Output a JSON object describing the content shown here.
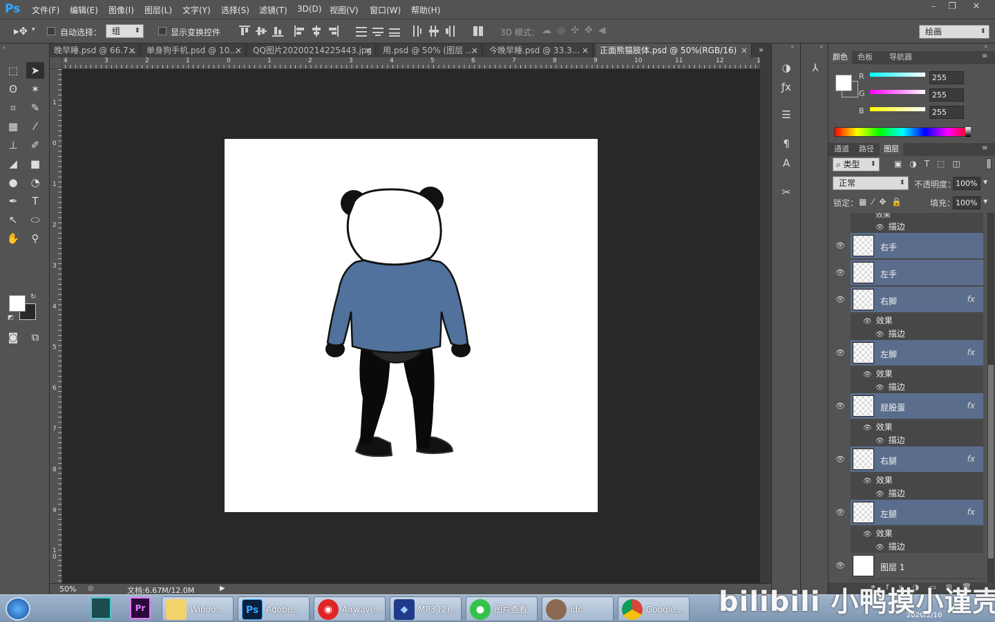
{
  "app": {
    "logo": "Ps"
  },
  "menu": [
    "文件(F)",
    "编辑(E)",
    "图像(I)",
    "图层(L)",
    "文字(Y)",
    "选择(S)",
    "滤镜(T)",
    "3D(D)",
    "视图(V)",
    "窗口(W)",
    "帮助(H)"
  ],
  "options": {
    "auto_select_label": "自动选择：",
    "auto_select_value": "组",
    "show_transform_label": "显示变换控件",
    "mode3d_label": "3D 模式：",
    "workspace": "绘画"
  },
  "tabs": [
    {
      "label": "晚早睡.psd @ 66.7...",
      "close": "×"
    },
    {
      "label": "单身狗手机.psd @ 10...",
      "close": "×"
    },
    {
      "label": "QQ图片20200214225443.jpg",
      "close": "×"
    },
    {
      "label": "用.psd @ 50% (图层 ...",
      "close": "×"
    },
    {
      "label": "今晚早睡.psd @ 33.3...",
      "close": "×"
    },
    {
      "label": "正面熊猫肢体.psd @ 50%(RGB/16)",
      "close": "×"
    }
  ],
  "ruler_top": [
    "4",
    "3",
    "2",
    "1",
    "0",
    "1",
    "2",
    "3",
    "4",
    "5",
    "6",
    "7",
    "8",
    "9",
    "10",
    "11",
    "12",
    "1"
  ],
  "ruler_left": [
    "1",
    "0",
    "1",
    "2",
    "3",
    "4",
    "5",
    "6",
    "7",
    "8",
    "9",
    "1 0"
  ],
  "status": {
    "zoom": "50%",
    "doc": "文档:6.67M/12.0M"
  },
  "color_panel": {
    "tabs": [
      "颜色",
      "色板",
      "导航器"
    ],
    "r_label": "R",
    "g_label": "G",
    "b_label": "B",
    "r": "255",
    "g": "255",
    "b": "255"
  },
  "layers_panel": {
    "tabs": [
      "通道",
      "路径",
      "图层"
    ],
    "filter": "类型",
    "blend_mode": "正常",
    "opacity_label": "不透明度：",
    "opacity": "100%",
    "lock_label": "锁定：",
    "fill_label": "填充：",
    "fill": "100%",
    "top_partial_effect": "效果",
    "top_partial_stroke": "描边",
    "layers": [
      {
        "name": "右手",
        "fx": "",
        "effect": "",
        "stroke": ""
      },
      {
        "name": "左手",
        "fx": "",
        "effect": "",
        "stroke": ""
      },
      {
        "name": "右脚",
        "fx": "fx",
        "effect": "效果",
        "stroke": "描边"
      },
      {
        "name": "左脚",
        "fx": "fx",
        "effect": "效果",
        "stroke": "描边"
      },
      {
        "name": "屁股蛋",
        "fx": "fx",
        "effect": "效果",
        "stroke": "描边"
      },
      {
        "name": "右腿",
        "fx": "fx",
        "effect": "效果",
        "stroke": "描边"
      },
      {
        "name": "左腿",
        "fx": "fx",
        "effect": "效果",
        "stroke": "描边"
      },
      {
        "name": "图层 1",
        "fx": "",
        "effect": "",
        "stroke": ""
      }
    ]
  },
  "taskbar": [
    {
      "label": "",
      "icon": "win-start-icon"
    },
    {
      "label": "Windo...",
      "icon": "folder-icon"
    },
    {
      "label": "Adobe...",
      "icon": "ps-icon"
    },
    {
      "label": "Airwave...",
      "icon": "netease-icon"
    },
    {
      "label": "MP3 (2)...",
      "icon": "media-icon"
    },
    {
      "label": "图片查看",
      "icon": "wechat-icon"
    },
    {
      "label": "idc",
      "icon": "avatar-icon"
    },
    {
      "label": "Google...",
      "icon": "chrome-icon"
    }
  ],
  "watermark": "bilibili 小鸭摸小谨壳",
  "clock": "2020/2/10"
}
